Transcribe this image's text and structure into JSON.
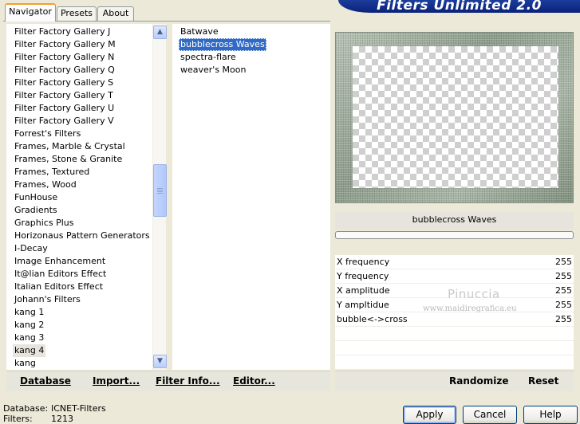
{
  "tabs": [
    {
      "label": "Navigator"
    },
    {
      "label": "Presets"
    },
    {
      "label": "About"
    }
  ],
  "banner_title": "Filters Unlimited 2.0",
  "categories": [
    "Filter Factory Gallery J",
    "Filter Factory Gallery M",
    "Filter Factory Gallery N",
    "Filter Factory Gallery Q",
    "Filter Factory Gallery S",
    "Filter Factory Gallery T",
    "Filter Factory Gallery U",
    "Filter Factory Gallery V",
    "Forrest's Filters",
    "Frames, Marble & Crystal",
    "Frames, Stone & Granite",
    "Frames, Textured",
    "Frames, Wood",
    "FunHouse",
    "Gradients",
    "Graphics Plus",
    "Horizonaus Pattern Generators",
    "I-Decay",
    "Image Enhancement",
    "It@lian Editors Effect",
    "Italian Editors Effect",
    "Johann's Filters",
    "kang 1",
    "kang 2",
    "kang 3",
    "kang 4",
    "kang"
  ],
  "selected_category": "kang 4",
  "filters": [
    "Batwave",
    "bubblecross Waves",
    "spectra-flare",
    "weaver's Moon"
  ],
  "selected_filter": "bubblecross Waves",
  "preview_filter_name": "bubblecross Waves",
  "parameters": [
    {
      "label": "X frequency",
      "value": "255"
    },
    {
      "label": "Y frequency",
      "value": "255"
    },
    {
      "label": "X amplitude",
      "value": "255"
    },
    {
      "label": "Y ampltidue",
      "value": "255"
    },
    {
      "label": "bubble<->cross",
      "value": "255"
    }
  ],
  "watermark": {
    "name": "Pinuccia",
    "site": "www.maidiregrafica.eu"
  },
  "left_bar": {
    "database_label": "Database",
    "import_label": "Import...",
    "filter_info_label": "Filter Info...",
    "editor_label": "Editor..."
  },
  "right_bar": {
    "randomize_label": "Randomize",
    "reset_label": "Reset"
  },
  "status": {
    "database_label": "Database:",
    "database_value": "ICNET-Filters",
    "filters_label": "Filters:",
    "filters_value": "1213"
  },
  "dialog_buttons": {
    "apply": "Apply",
    "cancel": "Cancel",
    "help": "Help"
  },
  "colors": {
    "banner": "#0a227a",
    "selection": "#316ac5",
    "window_bg": "#ece9d8"
  }
}
